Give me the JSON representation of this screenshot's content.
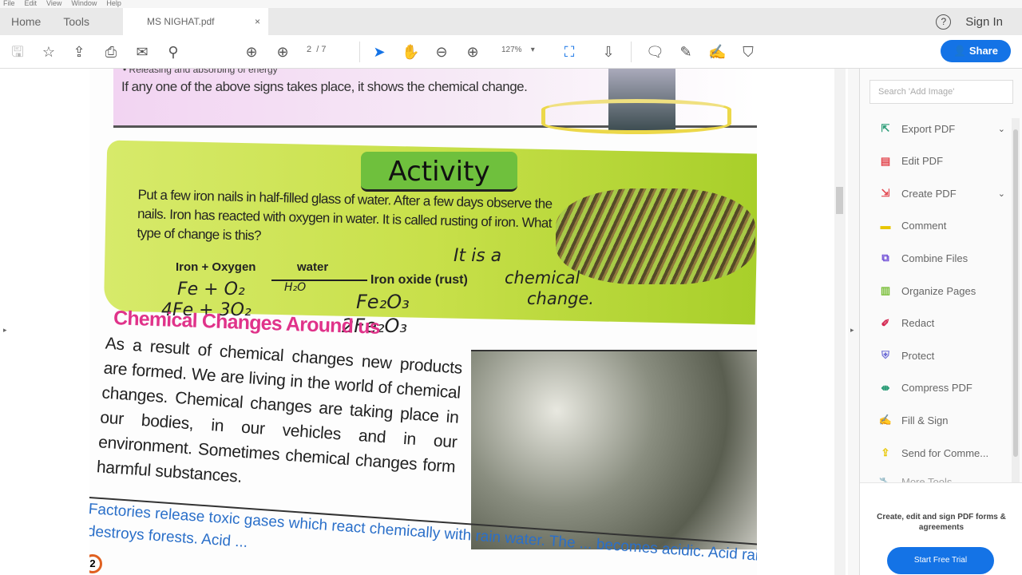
{
  "menu": [
    "File",
    "Edit",
    "View",
    "Window",
    "Help"
  ],
  "tabs": {
    "home": "Home",
    "tools": "Tools",
    "document": "MS NIGHAT.pdf",
    "close": "×"
  },
  "header": {
    "sign_in": "Sign In",
    "help": "?"
  },
  "toolbar": {
    "page_current": "2",
    "page_total": "/ 7",
    "zoom": "127%",
    "share": "Share"
  },
  "page": {
    "top_bullet": "• Releasing and absorbing of energy",
    "top_text": "If any one of the above signs takes place, it shows the chemical change.",
    "activity_title": "Activity",
    "activity_text": "Put a few iron nails in half-filled glass of water. After a few days observe the nails. Iron has reacted with oxygen in water. It is called rusting of iron. What type of change is this?",
    "equation_left": "Iron + Oxygen",
    "equation_over": "water",
    "equation_right": "Iron oxide (rust)",
    "hand_answer1": "It is a",
    "hand_answer2": "chemical",
    "hand_answer3": "change.",
    "hand_eq1": "Fe + O₂",
    "hand_eq1_over": "H₂O",
    "hand_eq1_right": "Fe₂O₃",
    "hand_eq2": "4Fe + 3O₂",
    "hand_eq2_right": "2Fe₂O₃",
    "section_heading": "Chemical Changes Around us",
    "paragraph": "As a result of chemical changes new products are formed. We are living in the world of chemical changes. Chemical changes are taking place in our bodies, in our vehicles and in our environment. Sometimes chemical changes form harmful substances.",
    "blue_text": "Factories release toxic gases which react chemically with rain water. The ... becomes acidic. Acid rain destroys forests. Acid ...",
    "page_number": "2"
  },
  "panel": {
    "search_placeholder": "Search 'Add Image'",
    "tools": [
      {
        "label": "Export PDF",
        "color": "#2d9d78"
      },
      {
        "label": "Edit PDF",
        "color": "#e34850"
      },
      {
        "label": "Create PDF",
        "color": "#e34850"
      },
      {
        "label": "Comment",
        "color": "#e8c600"
      },
      {
        "label": "Combine Files",
        "color": "#6e4cd6"
      },
      {
        "label": "Organize Pages",
        "color": "#7bbf3a"
      },
      {
        "label": "Redact",
        "color": "#d3254f"
      },
      {
        "label": "Protect",
        "color": "#6e6ed6"
      },
      {
        "label": "Compress PDF",
        "color": "#2d9d78"
      },
      {
        "label": "Fill & Sign",
        "color": "#8c5ad6"
      },
      {
        "label": "Send for Comme...",
        "color": "#e8c600"
      },
      {
        "label": "More Tools",
        "color": "#555"
      }
    ],
    "promo": "Create, edit and sign PDF forms & agreements",
    "trial": "Start Free Trial"
  }
}
